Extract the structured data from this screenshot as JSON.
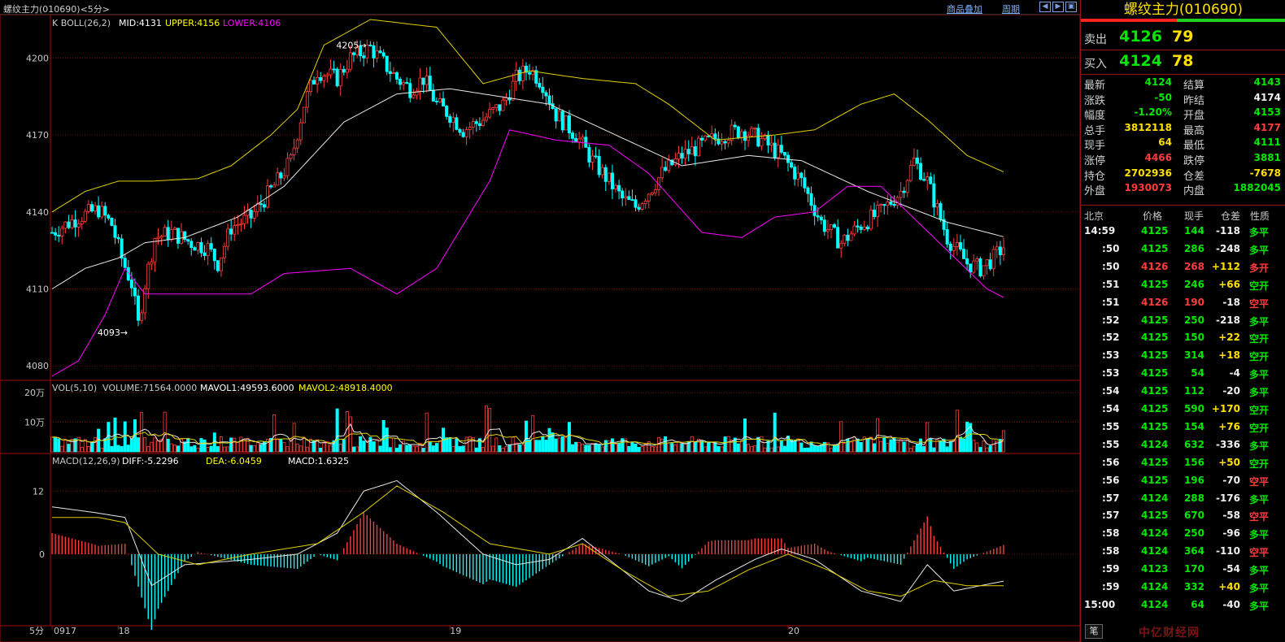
{
  "window": {
    "title": "螺纹主力(010690)<5分>",
    "overlay_link": "商品叠加",
    "period_link": "周期"
  },
  "chart_data": [
    {
      "type": "candlestick",
      "title": "K  BOLL(26,2)",
      "indicators": [
        {
          "label": "MID:4131",
          "color": "#ffffff"
        },
        {
          "label": "UPPER:4156",
          "color": "#ffff00"
        },
        {
          "label": "LOWER:4106",
          "color": "#ff00ff"
        }
      ],
      "y_ticks": [
        4200,
        4170,
        4140,
        4110,
        4080
      ],
      "ylim": [
        4075,
        4215
      ],
      "annotations": [
        {
          "text": "4205",
          "x": 96,
          "y": 4205
        },
        {
          "text": "4093",
          "x": 24,
          "y": 4093
        }
      ],
      "bars": {
        "start_close": 4132,
        "count": 196,
        "keyframes": [
          [
            0,
            4132
          ],
          [
            8,
            4138
          ],
          [
            14,
            4141
          ],
          [
            18,
            4135
          ],
          [
            21,
            4122
          ],
          [
            24,
            4112
          ],
          [
            26,
            4096
          ],
          [
            28,
            4112
          ],
          [
            31,
            4130
          ],
          [
            36,
            4132
          ],
          [
            42,
            4128
          ],
          [
            47,
            4126
          ],
          [
            50,
            4120
          ],
          [
            54,
            4134
          ],
          [
            60,
            4138
          ],
          [
            64,
            4145
          ],
          [
            68,
            4152
          ],
          [
            72,
            4160
          ],
          [
            76,
            4182
          ],
          [
            80,
            4195
          ],
          [
            86,
            4192
          ],
          [
            90,
            4200
          ],
          [
            96,
            4204
          ],
          [
            100,
            4198
          ],
          [
            104,
            4192
          ],
          [
            108,
            4188
          ],
          [
            112,
            4192
          ],
          [
            116,
            4182
          ],
          [
            120,
            4178
          ],
          [
            124,
            4172
          ],
          [
            130,
            4176
          ],
          [
            136,
            4182
          ],
          [
            140,
            4192
          ],
          [
            144,
            4196
          ],
          [
            148,
            4190
          ],
          [
            152,
            4178
          ],
          [
            158,
            4170
          ],
          [
            163,
            4160
          ],
          [
            168,
            4152
          ],
          [
            172,
            4145
          ],
          [
            176,
            4142
          ],
          [
            180,
            4148
          ],
          [
            184,
            4155
          ],
          [
            190,
            4162
          ],
          [
            196,
            4166
          ],
          [
            202,
            4170
          ],
          [
            208,
            4172
          ],
          [
            214,
            4168
          ],
          [
            220,
            4162
          ],
          [
            226,
            4152
          ],
          [
            232,
            4136
          ],
          [
            238,
            4128
          ],
          [
            244,
            4135
          ],
          [
            250,
            4140
          ],
          [
            256,
            4148
          ],
          [
            260,
            4160
          ],
          [
            264,
            4152
          ],
          [
            270,
            4130
          ],
          [
            276,
            4120
          ],
          [
            280,
            4118
          ],
          [
            284,
            4122
          ],
          [
            288,
            4128
          ]
        ]
      },
      "boll": {
        "mid": [
          [
            0,
            4110
          ],
          [
            10,
            4118
          ],
          [
            20,
            4122
          ],
          [
            28,
            4128
          ],
          [
            40,
            4130
          ],
          [
            56,
            4138
          ],
          [
            70,
            4150
          ],
          [
            88,
            4175
          ],
          [
            104,
            4186
          ],
          [
            120,
            4188
          ],
          [
            150,
            4182
          ],
          [
            170,
            4170
          ],
          [
            190,
            4158
          ],
          [
            210,
            4162
          ],
          [
            226,
            4160
          ],
          [
            246,
            4148
          ],
          [
            270,
            4136
          ],
          [
            288,
            4130
          ]
        ],
        "upper": [
          [
            0,
            4140
          ],
          [
            10,
            4148
          ],
          [
            20,
            4152
          ],
          [
            30,
            4152
          ],
          [
            44,
            4153
          ],
          [
            54,
            4158
          ],
          [
            66,
            4170
          ],
          [
            74,
            4180
          ],
          [
            82,
            4205
          ],
          [
            96,
            4215
          ],
          [
            116,
            4212
          ],
          [
            130,
            4190
          ],
          [
            144,
            4195
          ],
          [
            160,
            4192
          ],
          [
            176,
            4190
          ],
          [
            186,
            4182
          ],
          [
            200,
            4168
          ],
          [
            218,
            4170
          ],
          [
            230,
            4172
          ],
          [
            244,
            4182
          ],
          [
            254,
            4186
          ],
          [
            264,
            4176
          ],
          [
            276,
            4162
          ],
          [
            288,
            4155
          ]
        ],
        "lower": [
          [
            0,
            4076
          ],
          [
            8,
            4082
          ],
          [
            16,
            4100
          ],
          [
            22,
            4118
          ],
          [
            28,
            4108
          ],
          [
            40,
            4108
          ],
          [
            60,
            4108
          ],
          [
            70,
            4116
          ],
          [
            90,
            4118
          ],
          [
            104,
            4108
          ],
          [
            116,
            4118
          ],
          [
            132,
            4152
          ],
          [
            138,
            4172
          ],
          [
            152,
            4168
          ],
          [
            168,
            4166
          ],
          [
            180,
            4155
          ],
          [
            196,
            4132
          ],
          [
            208,
            4130
          ],
          [
            218,
            4138
          ],
          [
            230,
            4140
          ],
          [
            240,
            4150
          ],
          [
            250,
            4150
          ],
          [
            262,
            4135
          ],
          [
            274,
            4120
          ],
          [
            282,
            4110
          ],
          [
            288,
            4106
          ]
        ]
      }
    },
    {
      "type": "bar",
      "title": "VOL(5,10)",
      "indicators": [
        {
          "label": "VOLUME:71564.0000",
          "color": "#c8c8c8"
        },
        {
          "label": "MAVOL1:49593.6000",
          "color": "#ffffff"
        },
        {
          "label": "MAVOL2:48918.4000",
          "color": "#ffff00"
        }
      ],
      "y_ticks": [
        "20万",
        "10万"
      ],
      "ylim": [
        0,
        240000
      ],
      "last_value": 71564
    },
    {
      "type": "bar",
      "title": "MACD(12,26,9)",
      "indicators": [
        {
          "label": "DIFF:-5.2296",
          "color": "#ffffff"
        },
        {
          "label": "DEA:-6.0459",
          "color": "#ffff00"
        },
        {
          "label": "MACD:1.6325",
          "color": "#ffffff"
        }
      ],
      "y_ticks": [
        12,
        0
      ],
      "ylim": [
        -13,
        17
      ],
      "diff": [
        [
          0,
          9
        ],
        [
          12,
          8
        ],
        [
          22,
          7
        ],
        [
          30,
          -6
        ],
        [
          40,
          -2
        ],
        [
          60,
          -1
        ],
        [
          74,
          0
        ],
        [
          86,
          4
        ],
        [
          94,
          12
        ],
        [
          104,
          14
        ],
        [
          116,
          8
        ],
        [
          130,
          0
        ],
        [
          140,
          -2
        ],
        [
          150,
          -1
        ],
        [
          160,
          3
        ],
        [
          170,
          -2
        ],
        [
          180,
          -7
        ],
        [
          190,
          -9
        ],
        [
          200,
          -5
        ],
        [
          212,
          -1
        ],
        [
          220,
          1
        ],
        [
          230,
          -1
        ],
        [
          244,
          -7
        ],
        [
          256,
          -9
        ],
        [
          264,
          -2
        ],
        [
          272,
          -7
        ],
        [
          288,
          -5
        ]
      ],
      "dea": [
        [
          0,
          7
        ],
        [
          14,
          7
        ],
        [
          22,
          6
        ],
        [
          32,
          0
        ],
        [
          44,
          -2
        ],
        [
          60,
          0
        ],
        [
          80,
          2
        ],
        [
          94,
          8
        ],
        [
          104,
          13
        ],
        [
          118,
          8
        ],
        [
          132,
          2
        ],
        [
          150,
          0
        ],
        [
          160,
          2
        ],
        [
          172,
          -3
        ],
        [
          186,
          -8
        ],
        [
          198,
          -7
        ],
        [
          210,
          -3
        ],
        [
          222,
          0
        ],
        [
          234,
          -3
        ],
        [
          246,
          -7
        ],
        [
          256,
          -8
        ],
        [
          266,
          -5
        ],
        [
          276,
          -6
        ],
        [
          288,
          -6
        ]
      ]
    }
  ],
  "x_axis": {
    "period": "5分",
    "labels": [
      {
        "text": "0917",
        "i": 0
      },
      {
        "text": "18",
        "i": 20
      },
      {
        "text": "19",
        "i": 120
      },
      {
        "text": "20",
        "i": 222
      }
    ]
  },
  "quote": {
    "title": "螺纹主力(010690)",
    "sell": {
      "label": "卖出",
      "price": "4126",
      "vol": "79"
    },
    "buy": {
      "label": "买入",
      "price": "4124",
      "vol": "78"
    },
    "stats": [
      {
        "l1": "最新",
        "v1": "4124",
        "c1": "green",
        "l2": "结算",
        "v2": "4143",
        "c2": "green"
      },
      {
        "l1": "涨跌",
        "v1": "-50",
        "c1": "green",
        "l2": "昨结",
        "v2": "4174",
        "c2": "white"
      },
      {
        "l1": "幅度",
        "v1": "-1.20%",
        "c1": "green",
        "l2": "开盘",
        "v2": "4153",
        "c2": "green"
      },
      {
        "l1": "总手",
        "v1": "3812118",
        "c1": "yellow",
        "l2": "最高",
        "v2": "4177",
        "c2": "red"
      },
      {
        "l1": "现手",
        "v1": "64",
        "c1": "yellow",
        "l2": "最低",
        "v2": "4111",
        "c2": "green"
      },
      {
        "l1": "涨停",
        "v1": "4466",
        "c1": "red",
        "l2": "跌停",
        "v2": "3881",
        "c2": "green"
      },
      {
        "l1": "持仓",
        "v1": "2702936",
        "c1": "yellow",
        "l2": "仓差",
        "v2": "-7678",
        "c2": "yellow"
      },
      {
        "l1": "外盘",
        "v1": "1930073",
        "c1": "red",
        "l2": "内盘",
        "v2": "1882045",
        "c2": "green"
      }
    ],
    "tick_header": {
      "time": "北京",
      "price": "价格",
      "vol": "现手",
      "diff": "仓差",
      "nature": "性质"
    },
    "ticks": [
      {
        "t": "14:59",
        "p": "4125",
        "pc": "green",
        "v": "144",
        "d": "-118",
        "n": "多平",
        "nc": "green"
      },
      {
        "t": ":50",
        "p": "4125",
        "pc": "green",
        "v": "286",
        "d": "-248",
        "n": "多平",
        "nc": "green"
      },
      {
        "t": ":50",
        "p": "4126",
        "pc": "red",
        "v": "268",
        "d": "+112",
        "n": "多开",
        "nc": "red"
      },
      {
        "t": ":51",
        "p": "4125",
        "pc": "green",
        "v": "246",
        "d": "+66",
        "n": "空开",
        "nc": "green"
      },
      {
        "t": ":51",
        "p": "4126",
        "pc": "red",
        "v": "190",
        "d": "-18",
        "n": "空平",
        "nc": "red"
      },
      {
        "t": ":52",
        "p": "4125",
        "pc": "green",
        "v": "250",
        "d": "-218",
        "n": "多平",
        "nc": "green"
      },
      {
        "t": ":52",
        "p": "4125",
        "pc": "green",
        "v": "150",
        "d": "+22",
        "n": "空开",
        "nc": "green"
      },
      {
        "t": ":53",
        "p": "4125",
        "pc": "green",
        "v": "314",
        "d": "+18",
        "n": "空开",
        "nc": "green"
      },
      {
        "t": ":53",
        "p": "4125",
        "pc": "green",
        "v": "54",
        "d": "-4",
        "n": "多平",
        "nc": "green"
      },
      {
        "t": ":54",
        "p": "4125",
        "pc": "green",
        "v": "112",
        "d": "-20",
        "n": "多平",
        "nc": "green"
      },
      {
        "t": ":54",
        "p": "4125",
        "pc": "green",
        "v": "590",
        "d": "+170",
        "n": "空开",
        "nc": "green"
      },
      {
        "t": ":55",
        "p": "4125",
        "pc": "green",
        "v": "154",
        "d": "+76",
        "n": "空开",
        "nc": "green"
      },
      {
        "t": ":55",
        "p": "4124",
        "pc": "green",
        "v": "632",
        "d": "-336",
        "n": "多平",
        "nc": "green"
      },
      {
        "t": ":56",
        "p": "4125",
        "pc": "green",
        "v": "156",
        "d": "+50",
        "n": "空开",
        "nc": "green"
      },
      {
        "t": ":56",
        "p": "4125",
        "pc": "green",
        "v": "196",
        "d": "-70",
        "n": "空平",
        "nc": "red"
      },
      {
        "t": ":57",
        "p": "4124",
        "pc": "green",
        "v": "288",
        "d": "-176",
        "n": "多平",
        "nc": "green"
      },
      {
        "t": ":57",
        "p": "4125",
        "pc": "green",
        "v": "670",
        "d": "-58",
        "n": "空平",
        "nc": "red"
      },
      {
        "t": ":58",
        "p": "4124",
        "pc": "green",
        "v": "250",
        "d": "-96",
        "n": "多平",
        "nc": "green"
      },
      {
        "t": ":58",
        "p": "4124",
        "pc": "green",
        "v": "364",
        "d": "-110",
        "n": "空平",
        "nc": "red"
      },
      {
        "t": ":59",
        "p": "4123",
        "pc": "green",
        "v": "170",
        "d": "-54",
        "n": "多平",
        "nc": "green"
      },
      {
        "t": ":59",
        "p": "4124",
        "pc": "green",
        "v": "332",
        "d": "+40",
        "n": "多平",
        "nc": "green"
      },
      {
        "t": "15:00",
        "p": "4124",
        "pc": "green",
        "v": "64",
        "d": "-40",
        "n": "多平",
        "nc": "green"
      }
    ]
  },
  "bottom": {
    "tab": "笔",
    "watermark": "中亿财经网"
  }
}
